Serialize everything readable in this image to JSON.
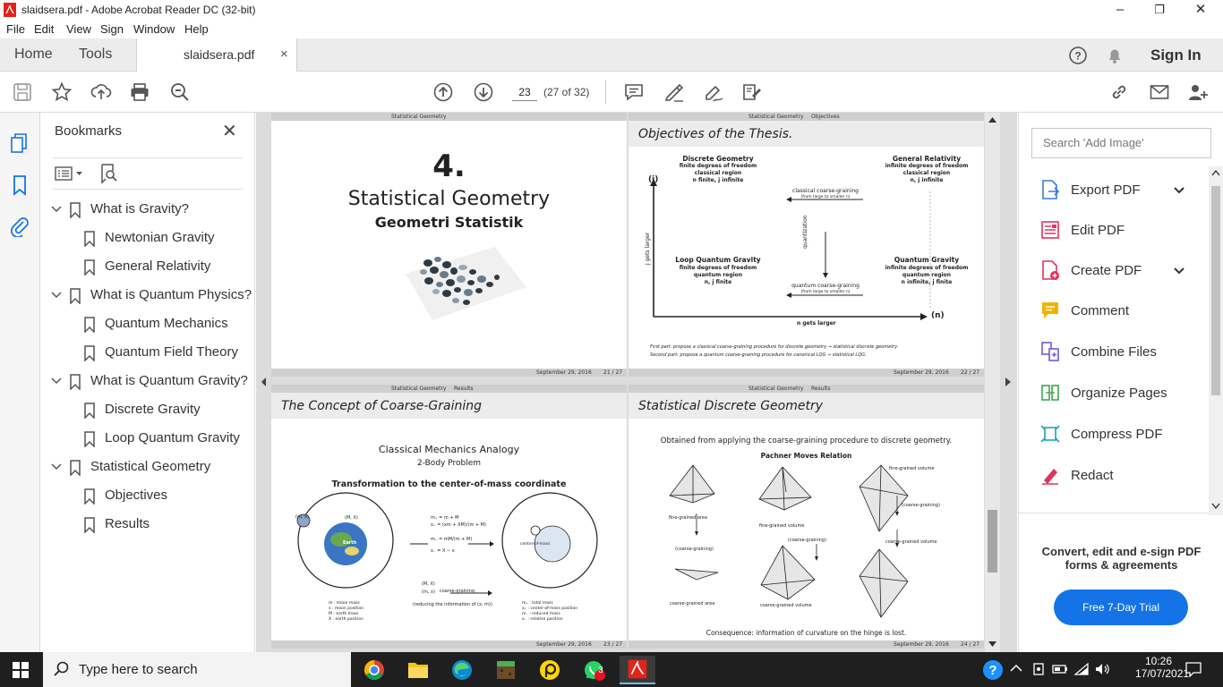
{
  "window": {
    "title": "slaidsera.pdf - Adobe Acrobat Reader DC (32-bit)",
    "minimize": "–",
    "maximize": "❐",
    "close": "✕"
  },
  "menu": [
    "File",
    "Edit",
    "View",
    "Sign",
    "Window",
    "Help"
  ],
  "tabs": {
    "home": "Home",
    "tools": "Tools",
    "document": "slaidsera.pdf",
    "close": "×",
    "sign_in": "Sign In"
  },
  "toolbar": {
    "page_number": "23",
    "page_count": "(27 of 32)"
  },
  "bookmarks": {
    "title": "Bookmarks",
    "close": "✕",
    "items": [
      {
        "label": "What is Gravity?",
        "level": 0,
        "expanded": true
      },
      {
        "label": "Newtonian Gravity",
        "level": 1
      },
      {
        "label": "General Relativity",
        "level": 1
      },
      {
        "label": "What is Quantum Physics?",
        "level": 0,
        "expanded": true
      },
      {
        "label": "Quantum Mechanics",
        "level": 1
      },
      {
        "label": "Quantum Field Theory",
        "level": 1
      },
      {
        "label": "What is Quantum Gravity?",
        "level": 0,
        "expanded": true
      },
      {
        "label": "Discrete Gravity",
        "level": 1
      },
      {
        "label": "Loop Quantum Gravity",
        "level": 1
      },
      {
        "label": "Statistical Geometry",
        "level": 0,
        "expanded": true
      },
      {
        "label": "Objectives",
        "level": 1
      },
      {
        "label": "Results",
        "level": 1
      }
    ]
  },
  "slides": {
    "s21": {
      "nav_section": "Statistical Geometry",
      "number": "4.",
      "title": "Statistical Geometry",
      "subtitle": "Geometri Statistik",
      "date": "September 29, 2016",
      "page": "21 / 27"
    },
    "s22": {
      "nav_section": "Statistical Geometry",
      "nav_sub": "Objectives",
      "frame_title": "Objectives of the Thesis.",
      "q_tl_title": "Discrete Geometry",
      "q_tl_l1": "finite degrees of freedom",
      "q_tl_l2": "classical region",
      "q_tl_l3": "n finite, j infinite",
      "q_tr_title": "General Relativity",
      "q_tr_l1": "infinite degrees of freedom",
      "q_tr_l2": "classical region",
      "q_tr_l3": "n, j infinite",
      "q_bl_title": "Loop Quantum Gravity",
      "q_bl_l1": "finite degrees of freedom",
      "q_bl_l2": "quantum region",
      "q_bl_l3": "n, j finite",
      "q_br_title": "Quantum Gravity",
      "q_br_l1": "infinite degrees of freedom",
      "q_br_l2": "quantum region",
      "q_br_l3": "n infinite, j finite",
      "arrow_top": "classical coarse-graining",
      "arrow_top_sub": "(from large to smaller n)",
      "arrow_bottom": "quantum coarse-graining",
      "arrow_bottom_sub": "(from large to smaller n)",
      "arrow_mid": "quantization",
      "axis_y": "(j)",
      "axis_y_label": "j gets larger",
      "axis_x": "(n)",
      "axis_x_label": "n gets larger",
      "bullet1": "First part: propose a classical coarse-graining procedure for discrete geometry → statistical discrete geometry.",
      "bullet2": "Second part: propose a quantum coarse-graining procedure for canonical LQG → statistical LQG.",
      "date": "September 29, 2016",
      "page": "22 / 27"
    },
    "s23": {
      "nav_section": "Statistical Geometry",
      "nav_sub": "Results",
      "frame_title": "The Concept of Coarse-Graining",
      "heading": "Classical Mechanics Analogy",
      "subheading": "2-Body Problem",
      "transform": "Transformation to the center-of-mass coordinate",
      "earth": "Earth",
      "label_mx": "(m, x)",
      "label_MX": "(M, X)",
      "eq1": "m₊ = m + M",
      "eq2": "x₊ = (xm + XM)/(m + M)",
      "eq3": "m₋ = mM/(m + M)",
      "eq4": "x₋ = X − x",
      "cg_label": "coarse-graining",
      "cg_note": "(reducing the information of (x, m))",
      "cm_label": "center-of-mass",
      "legend_left": [
        "m : moon mass",
        "x : moon position",
        "M : earth mass",
        "X : earth position"
      ],
      "legend_right": [
        "m₊ : total mass",
        "x₊ : center-of-mass position",
        "m₋ : reduced mass",
        "x₋ : relative position"
      ],
      "date": "September 29, 2016",
      "page": "23 / 27"
    },
    "s24": {
      "nav_section": "Statistical Geometry",
      "nav_sub": "Results",
      "frame_title": "Statistical Discrete Geometry",
      "intro": "Obtained from applying the coarse-graining procedure to discrete geometry.",
      "pachner": "Pachner Moves Relation",
      "fine_area": "fine-grained area",
      "fine_volume": "fine-grained volume",
      "coarse_area": "coarse-grained area",
      "coarse_volume": "coarse-grained volume",
      "coarse_graining": "(coarse-graining)",
      "consequence": "Consequence: information of curvature on the hinge is lost.",
      "date": "September 29, 2016",
      "page": "24 / 27"
    }
  },
  "right_panel": {
    "search_placeholder": "Search 'Add Image'",
    "tools": [
      {
        "label": "Export PDF",
        "icon": "export-pdf-icon",
        "color": "#3a7bd5",
        "chevron": true
      },
      {
        "label": "Edit PDF",
        "icon": "edit-pdf-icon",
        "color": "#e2325a",
        "chevron": false
      },
      {
        "label": "Create PDF",
        "icon": "create-pdf-icon",
        "color": "#e2325a",
        "chevron": true
      },
      {
        "label": "Comment",
        "icon": "comment-icon",
        "color": "#f0b400",
        "chevron": false
      },
      {
        "label": "Combine Files",
        "icon": "combine-files-icon",
        "color": "#6e5ad6",
        "chevron": false
      },
      {
        "label": "Organize Pages",
        "icon": "organize-pages-icon",
        "color": "#3fa34d",
        "chevron": false
      },
      {
        "label": "Compress PDF",
        "icon": "compress-pdf-icon",
        "color": "#1aa3b8",
        "chevron": false
      },
      {
        "label": "Redact",
        "icon": "redact-icon",
        "color": "#e2325a",
        "chevron": false
      }
    ],
    "promo_text": "Convert, edit and e-sign PDF forms & agreements",
    "trial_button": "Free 7-Day Trial"
  },
  "taskbar": {
    "search_text": "Type here to search",
    "time": "10:26",
    "date": "17/07/2021",
    "whatsapp_badge": "3"
  },
  "colors": {
    "accent": "#1473e6",
    "acrobat_red": "#e2231a"
  }
}
